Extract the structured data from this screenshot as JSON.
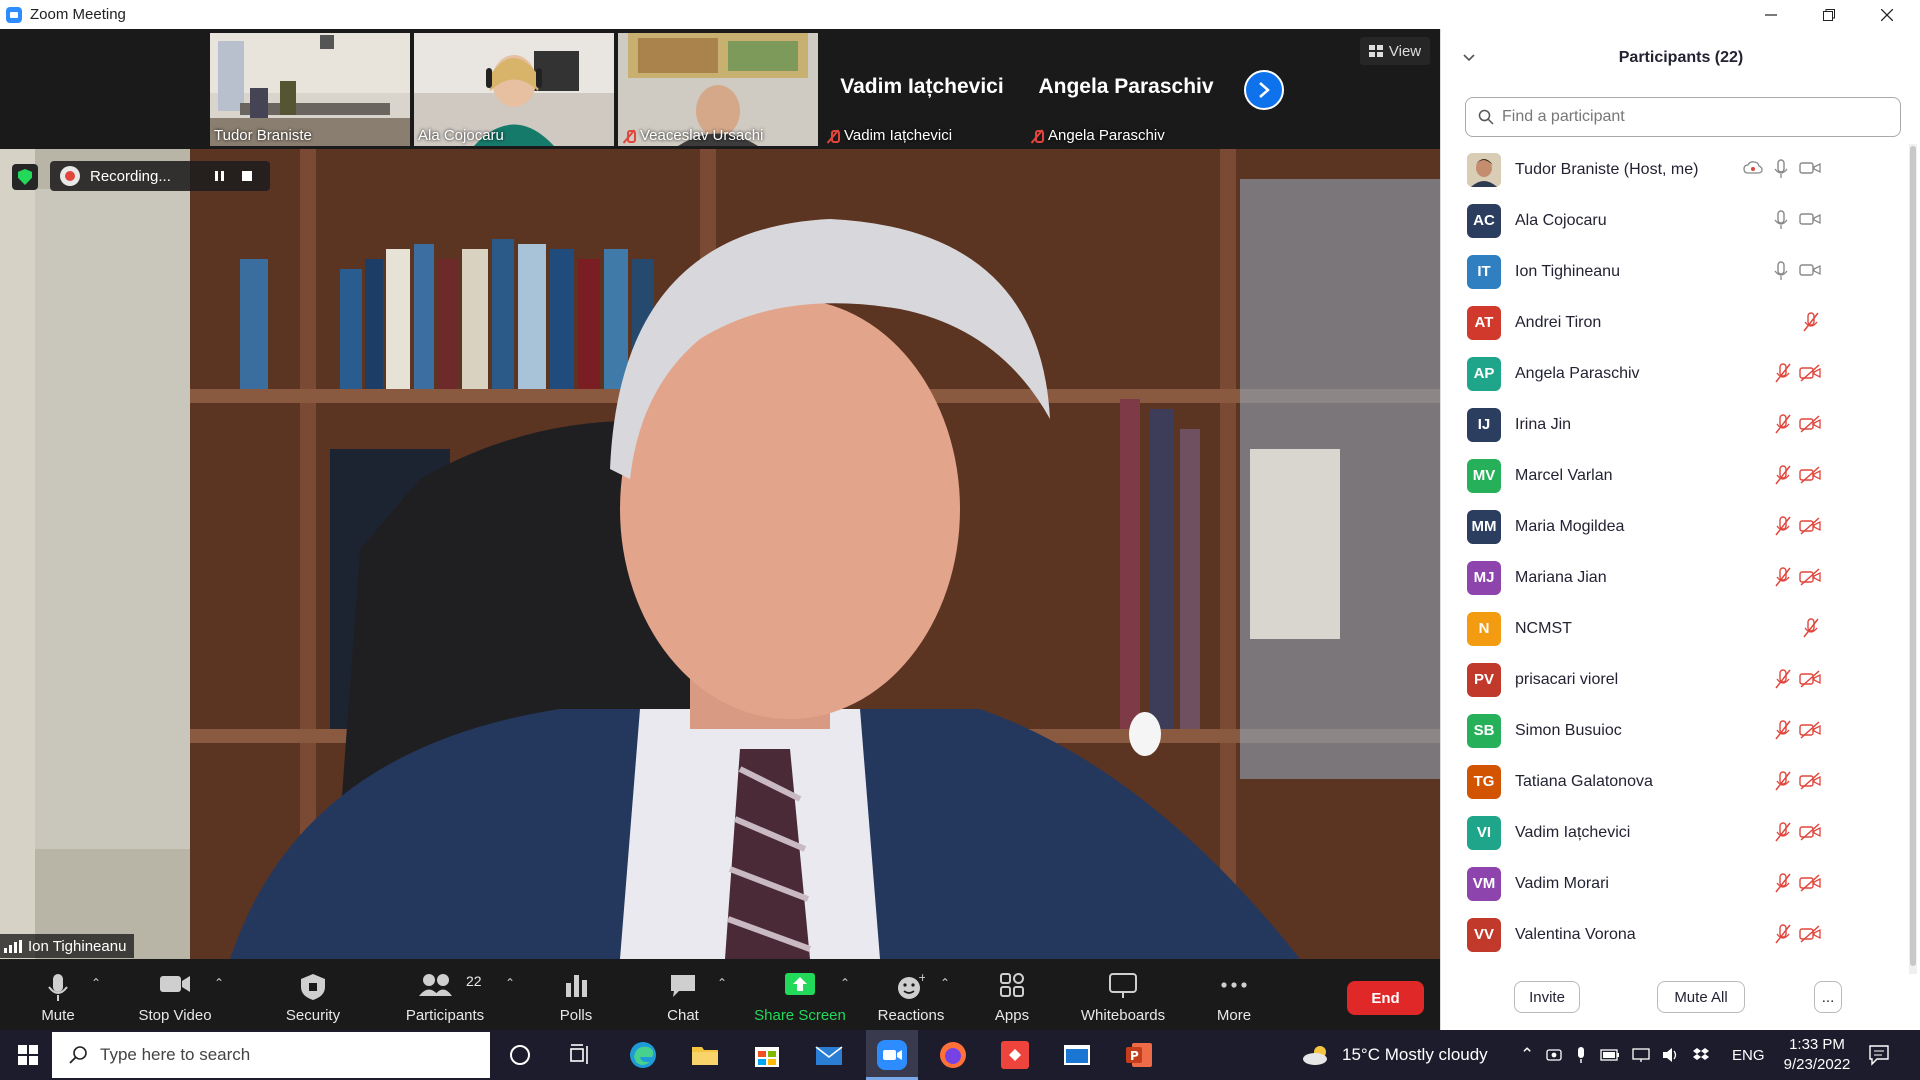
{
  "window": {
    "title": "Zoom Meeting"
  },
  "thumbnails": [
    {
      "name": "Tudor Braniste",
      "muted": false,
      "video": true
    },
    {
      "name": "Ala Cojocaru",
      "muted": false,
      "video": true
    },
    {
      "name": "Veaceslav Ursachi",
      "muted": true,
      "video": true
    },
    {
      "name": "Vadim Iațchevici",
      "muted": true,
      "video": false,
      "big_name": "Vadim Iațchevici"
    },
    {
      "name": "Angela Paraschiv",
      "muted": true,
      "video": false,
      "big_name": "Angela Paraschiv"
    }
  ],
  "view_button": "View",
  "recording": {
    "label": "Recording..."
  },
  "active_speaker": "Ion Tighineanu",
  "toolbar": {
    "mute": "Mute",
    "stop_video": "Stop Video",
    "security": "Security",
    "participants": "Participants",
    "participants_count": "22",
    "polls": "Polls",
    "chat": "Chat",
    "share_screen": "Share Screen",
    "reactions": "Reactions",
    "apps": "Apps",
    "whiteboards": "Whiteboards",
    "more": "More",
    "end": "End"
  },
  "panel": {
    "title": "Participants (22)",
    "search_placeholder": "Find a participant",
    "participants": [
      {
        "initials": "",
        "name": "Tudor Braniste (Host, me)",
        "color": "#9a8a74",
        "mic": "on",
        "cam": "on",
        "photo": true
      },
      {
        "initials": "AC",
        "name": "Ala Cojocaru",
        "color": "#2c3e60",
        "mic": "on",
        "cam": "on"
      },
      {
        "initials": "IT",
        "name": "Ion Tighineanu",
        "color": "#2f7fc1",
        "mic": "on",
        "cam": "on"
      },
      {
        "initials": "AT",
        "name": "Andrei Tiron",
        "color": "#d0392b",
        "mic": "off",
        "cam": "none"
      },
      {
        "initials": "AP",
        "name": "Angela Paraschiv",
        "color": "#1fa68a",
        "mic": "off",
        "cam": "off"
      },
      {
        "initials": "IJ",
        "name": "Irina Jin",
        "color": "#2c3e60",
        "mic": "off",
        "cam": "off"
      },
      {
        "initials": "MV",
        "name": "Marcel Varlan",
        "color": "#27b05a",
        "mic": "off",
        "cam": "off"
      },
      {
        "initials": "MM",
        "name": "Maria Mogildea",
        "color": "#2c3e60",
        "mic": "off",
        "cam": "off"
      },
      {
        "initials": "MJ",
        "name": "Mariana Jian",
        "color": "#8e44ad",
        "mic": "off",
        "cam": "off"
      },
      {
        "initials": "N",
        "name": "NCMST",
        "color": "#f39c12",
        "mic": "off",
        "cam": "none"
      },
      {
        "initials": "PV",
        "name": "prisacari viorel",
        "color": "#c0392b",
        "mic": "off",
        "cam": "off"
      },
      {
        "initials": "SB",
        "name": "Simon Busuioc",
        "color": "#27b05a",
        "mic": "off",
        "cam": "off"
      },
      {
        "initials": "TG",
        "name": "Tatiana Galatonova",
        "color": "#d35400",
        "mic": "off",
        "cam": "off"
      },
      {
        "initials": "VI",
        "name": "Vadim Iațchevici",
        "color": "#1fa68a",
        "mic": "off",
        "cam": "off"
      },
      {
        "initials": "VM",
        "name": "Vadim Morari",
        "color": "#8e44ad",
        "mic": "off",
        "cam": "off"
      },
      {
        "initials": "VV",
        "name": "Valentina Vorona",
        "color": "#c0392b",
        "mic": "off",
        "cam": "off"
      }
    ],
    "invite": "Invite",
    "mute_all": "Mute All",
    "more": "..."
  },
  "taskbar": {
    "search_placeholder": "Type here to search",
    "weather": "15°C  Mostly cloudy",
    "language": "ENG",
    "time": "1:33 PM",
    "date": "9/23/2022"
  },
  "colors": {
    "accent": "#0e72ed",
    "share_green": "#23d959",
    "end_red": "#e02828",
    "muted_red": "#e0463c"
  }
}
